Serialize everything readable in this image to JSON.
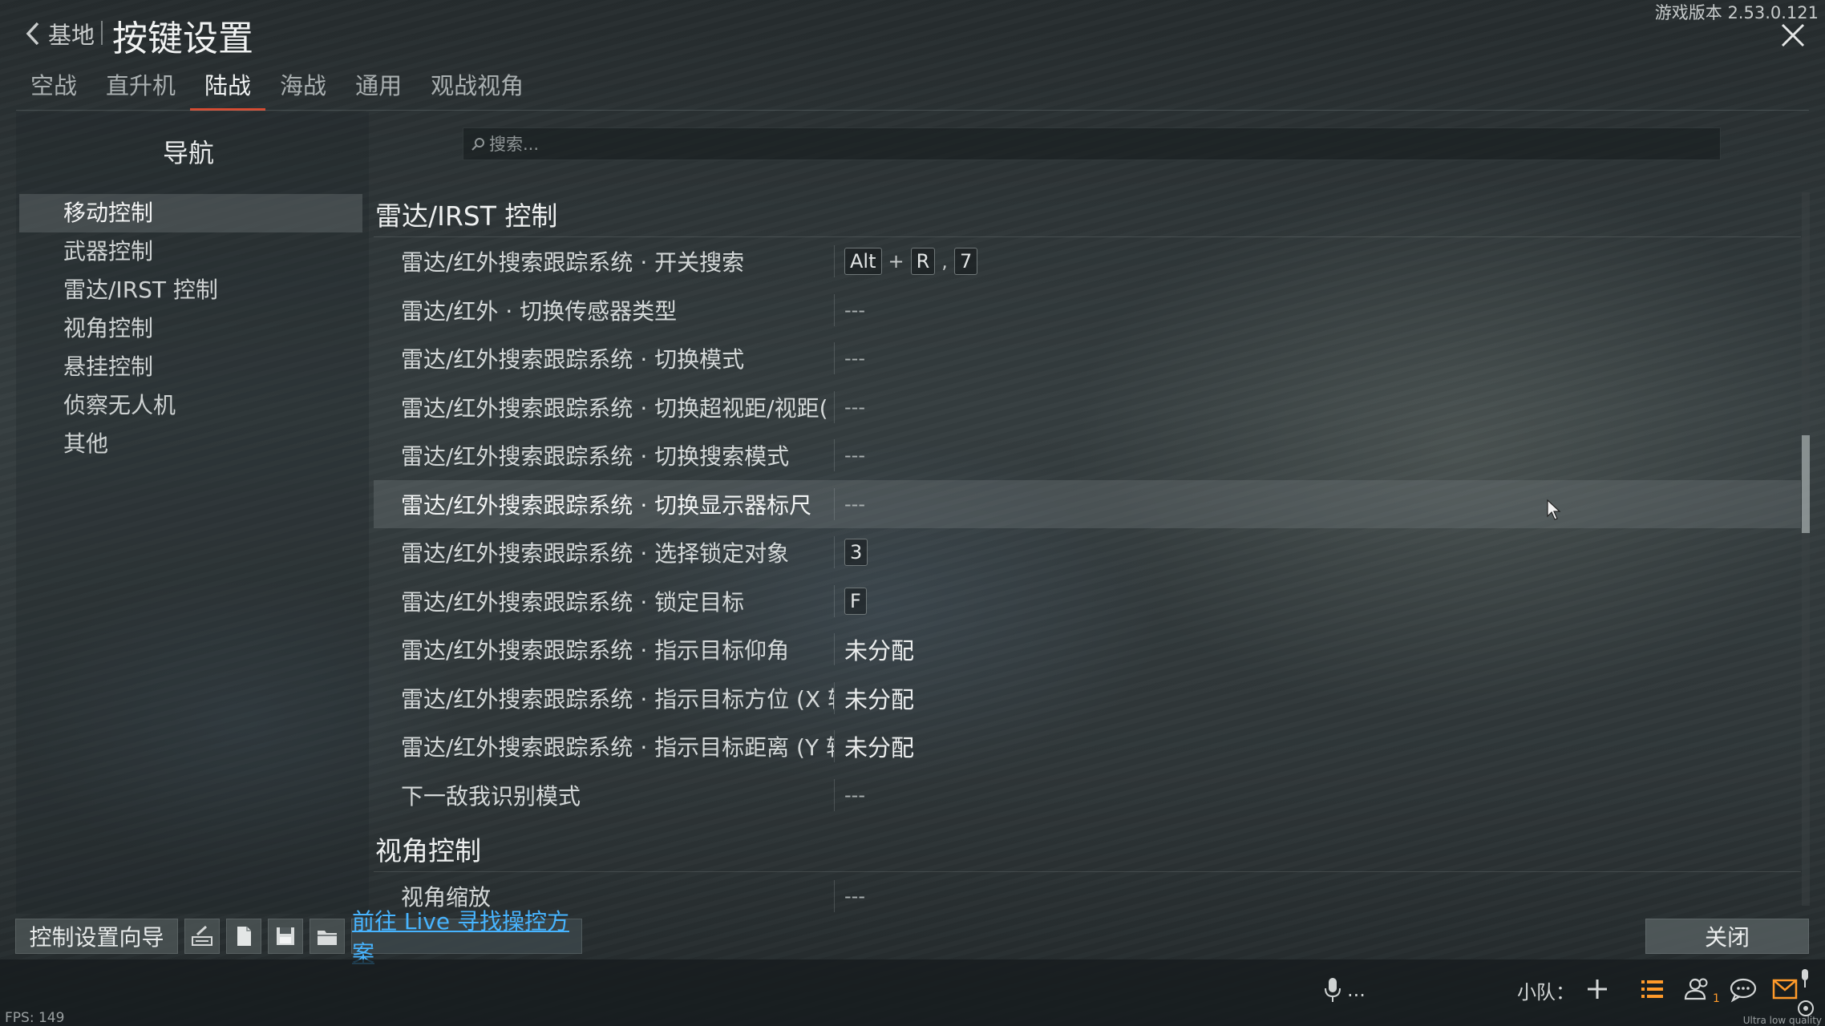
{
  "header": {
    "back_label": "基地",
    "title": "按键设置",
    "version": "游戏版本 2.53.0.121"
  },
  "tabs": [
    {
      "label": "空战"
    },
    {
      "label": "直升机"
    },
    {
      "label": "陆战",
      "active": true
    },
    {
      "label": "海战"
    },
    {
      "label": "通用"
    },
    {
      "label": "观战视角"
    }
  ],
  "nav": {
    "title": "导航",
    "items": [
      {
        "label": "移动控制",
        "active": true
      },
      {
        "label": "武器控制"
      },
      {
        "label": "雷达/IRST 控制"
      },
      {
        "label": "视角控制"
      },
      {
        "label": "悬挂控制"
      },
      {
        "label": "侦察无人机"
      },
      {
        "label": "其他"
      }
    ]
  },
  "search": {
    "placeholder": "搜索..."
  },
  "sections": [
    {
      "title": "雷达/IRST 控制",
      "rows": [
        {
          "label": "雷达/红外搜索跟踪系统 · 开关搜索",
          "keys": [
            "Alt",
            "+",
            "R",
            ",",
            "7"
          ]
        },
        {
          "label": "雷达/红外 · 切换传感器类型",
          "value": "---"
        },
        {
          "label": "雷达/红外搜索跟踪系统 · 切换模式",
          "value": "---"
        },
        {
          "label": "雷达/红外搜索跟踪系统 · 切换超视距/视距(",
          "value": "---"
        },
        {
          "label": "雷达/红外搜索跟踪系统 · 切换搜索模式",
          "value": "---"
        },
        {
          "label": "雷达/红外搜索跟踪系统 · 切换显示器标尺",
          "value": "---",
          "highlighted": true
        },
        {
          "label": "雷达/红外搜索跟踪系统 · 选择锁定对象",
          "keys": [
            "3"
          ]
        },
        {
          "label": "雷达/红外搜索跟踪系统 · 锁定目标",
          "keys": [
            "F"
          ]
        },
        {
          "label": "雷达/红外搜索跟踪系统 · 指示目标仰角",
          "value": "未分配"
        },
        {
          "label": "雷达/红外搜索跟踪系统 · 指示目标方位 (X 轴",
          "value": "未分配"
        },
        {
          "label": "雷达/红外搜索跟踪系统 · 指示目标距离 (Y 轴",
          "value": "未分配"
        },
        {
          "label": "下一敌我识别模式",
          "value": "---"
        }
      ]
    },
    {
      "title": "视角控制",
      "rows": [
        {
          "label": "视角缩放",
          "value": "---"
        }
      ]
    }
  ],
  "footer": {
    "wizard_label": "控制设置向导",
    "live_link_label": "前往 Live 寻找操控方案",
    "close_label": "关闭",
    "icons": [
      "keyboard-edit-icon",
      "new-file-icon",
      "save-icon",
      "open-folder-icon"
    ]
  },
  "status_bar": {
    "fps": "FPS: 149",
    "voice_text": "...",
    "squad_label": "小队：",
    "friends_badge": "1",
    "quality": "Ultra low quality"
  },
  "colors": {
    "accent_tab": "#d5492f",
    "link": "#47b4ff",
    "notification": "#ff9a2a"
  }
}
